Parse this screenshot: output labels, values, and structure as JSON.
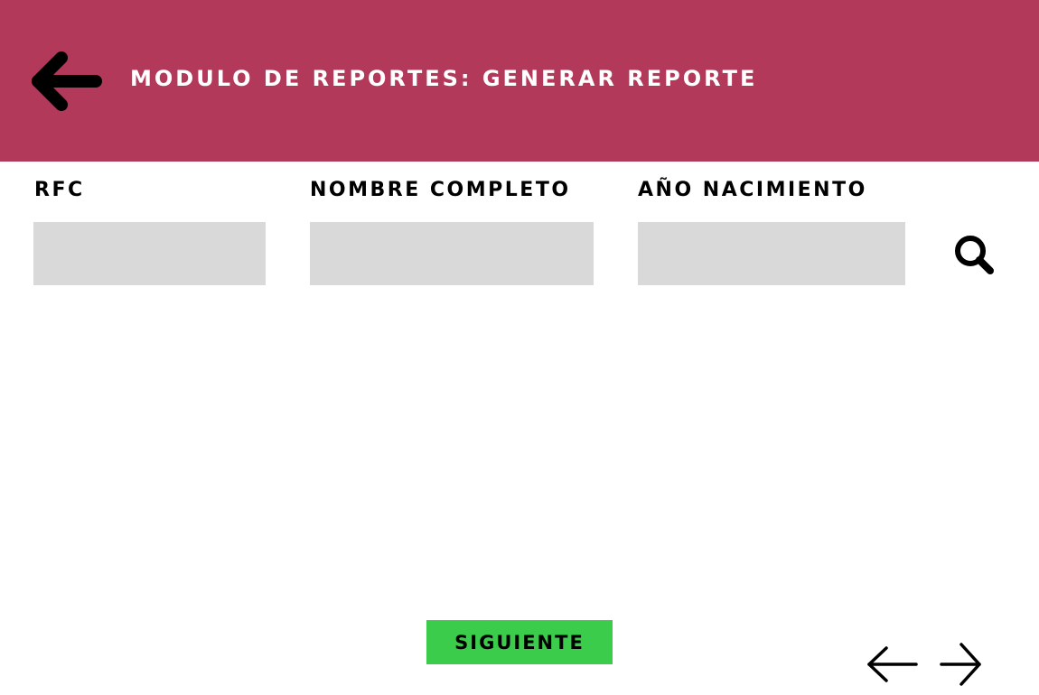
{
  "header": {
    "title": "MODULO DE REPORTES: GENERAR REPORTE",
    "background_color": "#b3395a",
    "back_icon": "arrow-left-icon"
  },
  "search_form": {
    "fields": [
      {
        "label": "RFC",
        "value": "",
        "placeholder": ""
      },
      {
        "label": "NOMBRE COMPLETO",
        "value": "",
        "placeholder": ""
      },
      {
        "label": "AÑO NACIMIENTO",
        "value": "",
        "placeholder": ""
      }
    ],
    "field_color": "#d9d9d9",
    "search_icon": "search-icon"
  },
  "footer": {
    "next_label": "SIGUIENTE",
    "next_color": "#3ccc4c",
    "prev_page_icon": "arrow-left-icon",
    "next_page_icon": "arrow-right-icon"
  }
}
